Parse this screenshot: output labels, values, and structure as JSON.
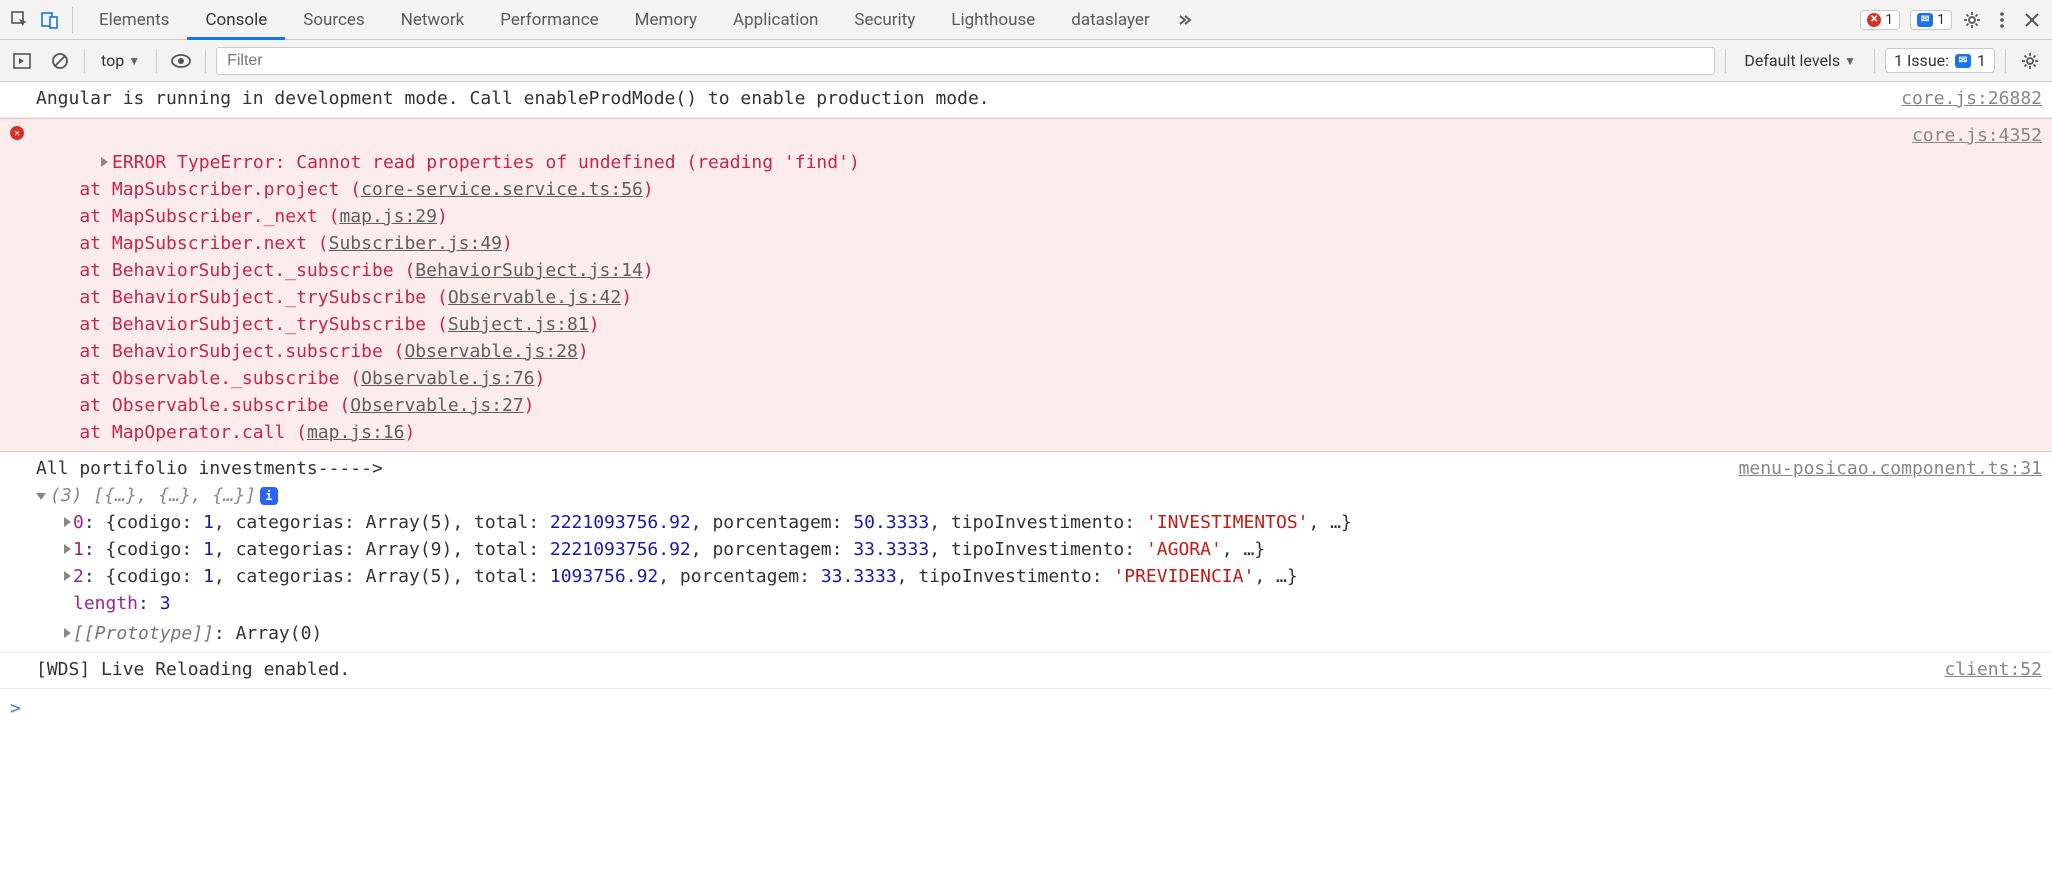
{
  "tabs": {
    "items": [
      "Elements",
      "Console",
      "Sources",
      "Network",
      "Performance",
      "Memory",
      "Application",
      "Security",
      "Lighthouse",
      "dataslayer"
    ],
    "active": "Console",
    "error_count": "1",
    "message_count": "1"
  },
  "toolbar": {
    "context_label": "top",
    "filter_placeholder": "Filter",
    "levels_label": "Default levels",
    "issues_label": "1 Issue:",
    "issues_count": "1"
  },
  "log": {
    "dev_mode": {
      "text": "Angular is running in development mode. Call enableProdMode() to enable production mode.",
      "src": "core.js:26882"
    },
    "error": {
      "head": "ERROR TypeError: Cannot read properties of undefined (reading 'find')",
      "src": "core.js:4352",
      "stack": [
        {
          "pre": "    at MapSubscriber.project (",
          "link": "core-service.service.ts:56",
          "post": ")"
        },
        {
          "pre": "    at MapSubscriber._next (",
          "link": "map.js:29",
          "post": ")"
        },
        {
          "pre": "    at MapSubscriber.next (",
          "link": "Subscriber.js:49",
          "post": ")"
        },
        {
          "pre": "    at BehaviorSubject._subscribe (",
          "link": "BehaviorSubject.js:14",
          "post": ")"
        },
        {
          "pre": "    at BehaviorSubject._trySubscribe (",
          "link": "Observable.js:42",
          "post": ")"
        },
        {
          "pre": "    at BehaviorSubject._trySubscribe (",
          "link": "Subject.js:81",
          "post": ")"
        },
        {
          "pre": "    at BehaviorSubject.subscribe (",
          "link": "Observable.js:28",
          "post": ")"
        },
        {
          "pre": "    at Observable._subscribe (",
          "link": "Observable.js:76",
          "post": ")"
        },
        {
          "pre": "    at Observable.subscribe (",
          "link": "Observable.js:27",
          "post": ")"
        },
        {
          "pre": "    at MapOperator.call (",
          "link": "map.js:16",
          "post": ")"
        }
      ]
    },
    "portfolio": {
      "label": "All portifolio investments----->",
      "src": "menu-posicao.component.ts:31",
      "arr_head": "(3) [{…}, {…}, {…}]",
      "items": [
        {
          "idx": "0",
          "codigo": "1",
          "cat": "Array(5)",
          "total": "2221093756.92",
          "porc": "50.3333",
          "tipo": "'INVESTIMENTOS'"
        },
        {
          "idx": "1",
          "codigo": "1",
          "cat": "Array(9)",
          "total": "2221093756.92",
          "porc": "33.3333",
          "tipo": "'AGORA'"
        },
        {
          "idx": "2",
          "codigo": "1",
          "cat": "Array(5)",
          "total": "1093756.92",
          "porc": "33.3333",
          "tipo": "'PREVIDENCIA'"
        }
      ],
      "length_label": "length",
      "length_val": "3",
      "proto_label": "[[Prototype]]",
      "proto_val": "Array(0)"
    },
    "wds": {
      "text": "[WDS] Live Reloading enabled.",
      "src": "client:52"
    }
  },
  "labels": {
    "codigo": "codigo",
    "categorias": "categorias",
    "total": "total",
    "porcentagem": "porcentagem",
    "tipoInvestimento": "tipoInvestimento"
  }
}
